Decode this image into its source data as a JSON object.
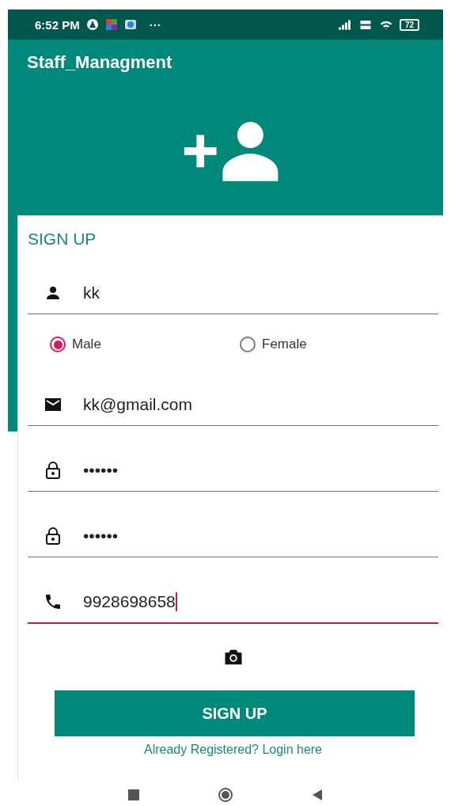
{
  "status_bar": {
    "time": "6:52 PM",
    "more": "···",
    "battery": "72"
  },
  "app_bar": {
    "title": "Staff_Managment"
  },
  "form": {
    "title": "SIGN UP",
    "fields": [
      {
        "kind": "person",
        "value": "kk",
        "focused": false
      },
      {
        "kind": "gender",
        "options": [
          {
            "label": "Male",
            "selected": true
          },
          {
            "label": "Female",
            "selected": false
          }
        ]
      },
      {
        "kind": "email",
        "value": "kk@gmail.com",
        "focused": false
      },
      {
        "kind": "lock",
        "value": "••••••",
        "focused": false
      },
      {
        "kind": "lock",
        "value": "••••••",
        "focused": false
      },
      {
        "kind": "phone",
        "value": "9928698658",
        "focused": true
      }
    ],
    "submit": "SIGN UP",
    "login_link": "Already Registered? Login here"
  }
}
